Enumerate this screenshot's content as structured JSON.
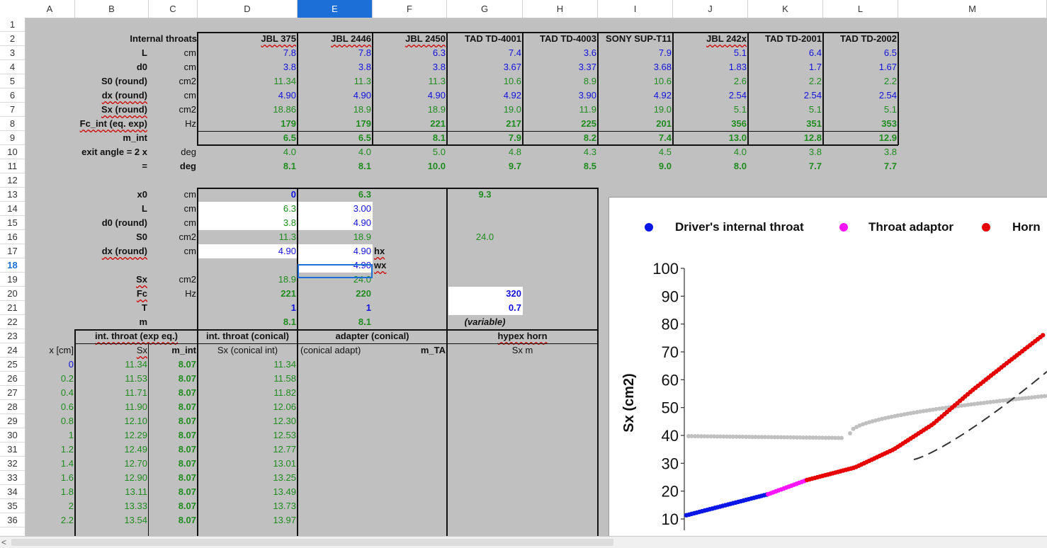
{
  "selected_cell": {
    "col": "E",
    "row": "18"
  },
  "columns": [
    {
      "letter": "A"
    },
    {
      "letter": "B"
    },
    {
      "letter": "C"
    },
    {
      "letter": "D"
    },
    {
      "letter": "E"
    },
    {
      "letter": "F"
    },
    {
      "letter": "G"
    },
    {
      "letter": "H"
    },
    {
      "letter": "I"
    },
    {
      "letter": "J"
    },
    {
      "letter": "K"
    },
    {
      "letter": "L"
    },
    {
      "letter": "M"
    }
  ],
  "rows": [
    "1",
    "2",
    "3",
    "4",
    "5",
    "6",
    "7",
    "8",
    "9",
    "10",
    "11",
    "12",
    "13",
    "14",
    "15",
    "16",
    "17",
    "18",
    "19",
    "20",
    "21",
    "22",
    "23",
    "24",
    "25",
    "26",
    "27",
    "28",
    "29",
    "30",
    "31",
    "32",
    "33",
    "34",
    "35",
    "36"
  ],
  "top_table": {
    "title": "Internal throats",
    "drivers": [
      "JBL 375",
      "JBL 2446",
      "JBL 2450",
      "TAD TD-4001",
      "TAD TD-4003",
      "SONY SUP-T11",
      "JBL 242x",
      "TAD TD-2001",
      "TAD TD-2002"
    ],
    "params": [
      {
        "label": "L",
        "unit": "cm",
        "values": [
          "7.8",
          "7.8",
          "6.3",
          "7.4",
          "3.6",
          "7.9",
          "5.1",
          "6.4",
          "6.5"
        ],
        "color": "blue",
        "bold": false
      },
      {
        "label": "d0",
        "unit": "cm",
        "values": [
          "3.8",
          "3.8",
          "3.8",
          "3.67",
          "3.37",
          "3.68",
          "1.83",
          "1.7",
          "1.67"
        ],
        "color": "blue",
        "bold": false
      },
      {
        "label": "S0 (round)",
        "unit": "cm2",
        "values": [
          "11.34",
          "11.3",
          "11.3",
          "10.6",
          "8.9",
          "10.6",
          "2.6",
          "2.2",
          "2.2"
        ],
        "color": "green",
        "bold": false
      },
      {
        "label": "dx (round)",
        "unit": "cm",
        "values": [
          "4.90",
          "4.90",
          "4.90",
          "4.92",
          "3.90",
          "4.92",
          "2.54",
          "2.54",
          "2.54"
        ],
        "color": "blue",
        "bold": false
      },
      {
        "label": "Sx (round)",
        "unit": "cm2",
        "values": [
          "18.86",
          "18.9",
          "18.9",
          "19.0",
          "11.9",
          "19.0",
          "5.1",
          "5.1",
          "5.1"
        ],
        "color": "green",
        "bold": false
      },
      {
        "label": "Fc_int (eq. exp)",
        "unit": "Hz",
        "values": [
          "179",
          "179",
          "221",
          "217",
          "225",
          "201",
          "356",
          "351",
          "353"
        ],
        "color": "green",
        "bold": true
      },
      {
        "label": "m_int",
        "unit": "",
        "values": [
          "6.5",
          "6.5",
          "8.1",
          "7.9",
          "8.2",
          "7.4",
          "13.0",
          "12.8",
          "12.9"
        ],
        "color": "green",
        "bold": true
      },
      {
        "label": "exit angle = 2 x",
        "unit": "deg",
        "values": [
          "4.0",
          "4.0",
          "5.0",
          "4.8",
          "4.3",
          "4.5",
          "4.0",
          "3.8",
          "3.8"
        ],
        "color": "green",
        "bold": false
      },
      {
        "label": "=",
        "unit": "deg",
        "values": [
          "8.1",
          "8.1",
          "10.0",
          "9.7",
          "8.5",
          "9.0",
          "8.0",
          "7.7",
          "7.7"
        ],
        "color": "green",
        "bold": true
      }
    ]
  },
  "mid_table": {
    "rows": [
      {
        "label": "x0",
        "unit": "cm",
        "d": "0",
        "e": "6.3",
        "g": "9.3"
      },
      {
        "label": "L",
        "unit": "cm",
        "d": "6.3",
        "e": "3.00",
        "g": ""
      },
      {
        "label": "d0 (round)",
        "unit": "cm",
        "d": "3.8",
        "e": "4.90",
        "g": ""
      },
      {
        "label": "S0",
        "unit": "cm2",
        "d": "11.3",
        "e": "18.9",
        "g": "24.0"
      },
      {
        "label": "dx (round)",
        "unit": "cm",
        "d": "4.90",
        "e": "4.90",
        "f": "hx",
        "g": ""
      },
      {
        "label": "",
        "unit": "",
        "d": "",
        "e": "4.90",
        "f": "wx",
        "g": ""
      },
      {
        "label": "Sx",
        "unit": "cm2",
        "d": "18.9",
        "e": "24.0",
        "g": ""
      },
      {
        "label": "Fc",
        "unit": "Hz",
        "d": "221",
        "e": "220",
        "g": "320"
      },
      {
        "label": "T",
        "unit": "",
        "d": "1",
        "e": "1",
        "g": "0.7"
      },
      {
        "label": "m",
        "unit": "",
        "d": "8.1",
        "e": "8.1",
        "g": "(variable)"
      }
    ],
    "section_headers": {
      "int_exp": "int. throat (exp eq.)",
      "int_conical": "int. throat (conical)",
      "adapter": "adapter (conical)",
      "hypex": "hypex horn"
    },
    "sub_headers": {
      "x": "x [cm]",
      "sx": "Sx",
      "m_int": "m_int",
      "sx_conical": "Sx (conical int)",
      "conical_adapt": "(conical adapt)",
      "m_ta": "m_TA",
      "sx_m": "Sx m"
    }
  },
  "data_rows": [
    {
      "x": "0",
      "sx": "11.34",
      "m": "8.07",
      "sxc": "11.34"
    },
    {
      "x": "0.2",
      "sx": "11.53",
      "m": "8.07",
      "sxc": "11.58"
    },
    {
      "x": "0.4",
      "sx": "11.71",
      "m": "8.07",
      "sxc": "11.82"
    },
    {
      "x": "0.6",
      "sx": "11.90",
      "m": "8.07",
      "sxc": "12.06"
    },
    {
      "x": "0.8",
      "sx": "12.10",
      "m": "8.07",
      "sxc": "12.30"
    },
    {
      "x": "1",
      "sx": "12.29",
      "m": "8.07",
      "sxc": "12.53"
    },
    {
      "x": "1.2",
      "sx": "12.49",
      "m": "8.07",
      "sxc": "12.77"
    },
    {
      "x": "1.4",
      "sx": "12.70",
      "m": "8.07",
      "sxc": "13.01"
    },
    {
      "x": "1.6",
      "sx": "12.90",
      "m": "8.07",
      "sxc": "13.25"
    },
    {
      "x": "1.8",
      "sx": "13.11",
      "m": "8.07",
      "sxc": "13.49"
    },
    {
      "x": "2",
      "sx": "13.33",
      "m": "8.07",
      "sxc": "13.73"
    },
    {
      "x": "2.2",
      "sx": "13.54",
      "m": "8.07",
      "sxc": "13.97"
    }
  ],
  "chart_data": {
    "type": "scatter",
    "title": "",
    "ylabel": "Sx (cm2)",
    "xlabel": "",
    "y_ticks": [
      10,
      20,
      30,
      40,
      50,
      60,
      70,
      80,
      90,
      100
    ],
    "ylim": [
      10,
      100
    ],
    "legend_position": "top",
    "legend": [
      {
        "name": "Driver's internal throat",
        "color": "#0a16e6"
      },
      {
        "name": "Throat adaptor",
        "color": "#ff14ff"
      },
      {
        "name": "Horn",
        "color": "#e60000"
      }
    ],
    "grey_series_color": "#c0c0c0",
    "dashed_line_color": "#333333",
    "series": [
      {
        "name": "Driver's internal throat",
        "x": [
          0,
          6.3
        ],
        "y": [
          11.34,
          18.9
        ]
      },
      {
        "name": "Throat adaptor",
        "x": [
          6.3,
          9.3
        ],
        "y": [
          18.9,
          24.0
        ]
      },
      {
        "name": "Horn",
        "x": [
          9.3,
          13,
          16,
          19,
          22,
          25,
          27.5
        ],
        "y": [
          24.0,
          28.5,
          35,
          44,
          56,
          67,
          76
        ]
      }
    ]
  },
  "scroll": {
    "left_arrow": "<"
  }
}
